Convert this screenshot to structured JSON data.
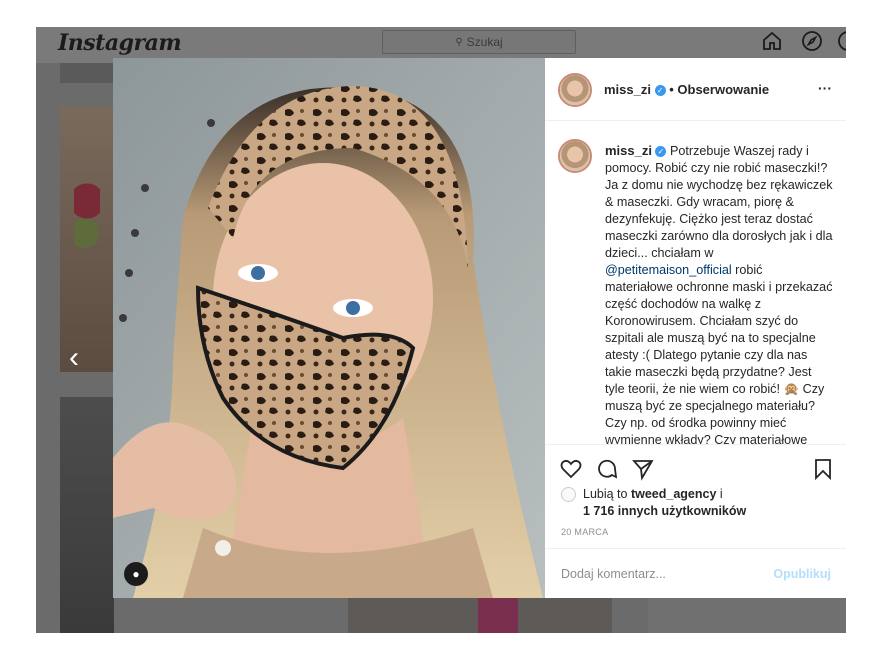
{
  "header": {
    "logo": "Instagram",
    "search_placeholder": "Szukaj"
  },
  "post": {
    "username": "miss_zi",
    "follow_status": "• Obserwowanie",
    "more_label": "···",
    "caption_user": "miss_zi",
    "caption_part1": "Potrzebuje Waszej rady i pomocy. Robić czy nie robić maseczki!?Ja z domu nie wychodzę bez rękawiczek & maseczki. Gdy wracam, piorę & dezynfekuję. Ciężko jest teraz dostać maseczki zarówno dla dorosłych jak i dla dzieci... chciałam w ",
    "caption_mention": "@petitemaison_official",
    "caption_part2": " robić materiałowe ochronne maski i przekazać część dochodów na walkę z Koronowirusem. Chciałam szyć do szpitali ale muszą być na to specjalne atesty :( Dlatego pytanie czy dla nas takie maseczki będą przydatne? Jest tyle teorii, że nie wiem co robić! 🙊 Czy muszą być ze specjalnego materiału? Czy np. od środka powinny mieć wymienne wkłady? Czy materiałowe maseczki wystarczy prać i",
    "likes_prefix": "Lubią to ",
    "likes_user": "tweed_agency",
    "likes_suffix": " i",
    "likes_count": "1 716 innych użytkowników",
    "date": "20 MARCA",
    "comment_placeholder": "Dodaj komentarz...",
    "post_button": "Opublikuj"
  },
  "colors": {
    "accent": "#3897f0",
    "post_button": "#b2dffc",
    "overlay": "#6b6b6b"
  }
}
